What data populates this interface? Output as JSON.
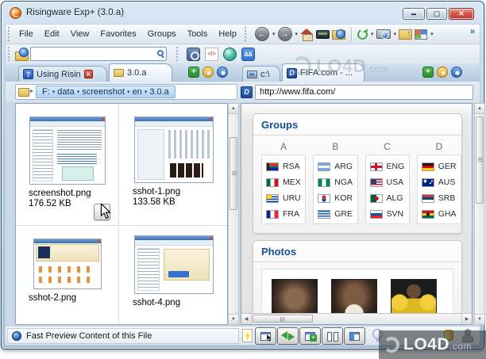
{
  "window": {
    "title": "Risingware Exp+  (3.0.a)"
  },
  "menu": {
    "items": [
      "File",
      "Edit",
      "View",
      "Favorites",
      "Groups",
      "Tools",
      "Help"
    ]
  },
  "toolbar": {
    "overflow": "»"
  },
  "search": {
    "value": ""
  },
  "left_pane": {
    "tabs": {
      "help_tab": "Using Risin",
      "folder_tab": "3.0.a"
    },
    "breadcrumb": {
      "items": [
        "F:",
        "data",
        "screenshot",
        "en",
        "3.0.a"
      ]
    },
    "files": [
      {
        "name": "screenshot.png",
        "size": "176.52 KB"
      },
      {
        "name": "sshot-1.png",
        "size": "133.58 KB"
      },
      {
        "name": "sshot-2.png"
      },
      {
        "name": "sshot-4.png"
      }
    ]
  },
  "right_pane": {
    "tabs": {
      "drive_tab": "c:\\",
      "site_tab": "FIFA.com - ..."
    },
    "address": {
      "url": "http://www.fifa.com/"
    },
    "page": {
      "groups": {
        "title": "Groups",
        "columns": [
          {
            "letter": "A",
            "teams": [
              {
                "code": "RSA",
                "flag": "rsa"
              },
              {
                "code": "MEX",
                "flag": "mex"
              },
              {
                "code": "URU",
                "flag": "uru"
              },
              {
                "code": "FRA",
                "flag": "fra"
              }
            ]
          },
          {
            "letter": "B",
            "teams": [
              {
                "code": "ARG",
                "flag": "arg"
              },
              {
                "code": "NGA",
                "flag": "nga"
              },
              {
                "code": "KOR",
                "flag": "kor"
              },
              {
                "code": "GRE",
                "flag": "gre"
              }
            ]
          },
          {
            "letter": "C",
            "teams": [
              {
                "code": "ENG",
                "flag": "eng"
              },
              {
                "code": "USA",
                "flag": "usa"
              },
              {
                "code": "ALG",
                "flag": "alg"
              },
              {
                "code": "SVN",
                "flag": "svn"
              }
            ]
          },
          {
            "letter": "D",
            "teams": [
              {
                "code": "GER",
                "flag": "ger"
              },
              {
                "code": "AUS",
                "flag": "aus"
              },
              {
                "code": "SRB",
                "flag": "srb"
              },
              {
                "code": "GHA",
                "flag": "gha"
              }
            ]
          }
        ]
      },
      "photos": {
        "title": "Photos"
      }
    }
  },
  "status_bar": {
    "text": "Fast Preview Content of this File"
  },
  "watermark": {
    "brand": "LO4D",
    "suffix": ".com"
  },
  "colors": {
    "accent_blue": "#14509e",
    "close_red": "#c03a30",
    "crumb_highlight": "#aed0f0"
  }
}
